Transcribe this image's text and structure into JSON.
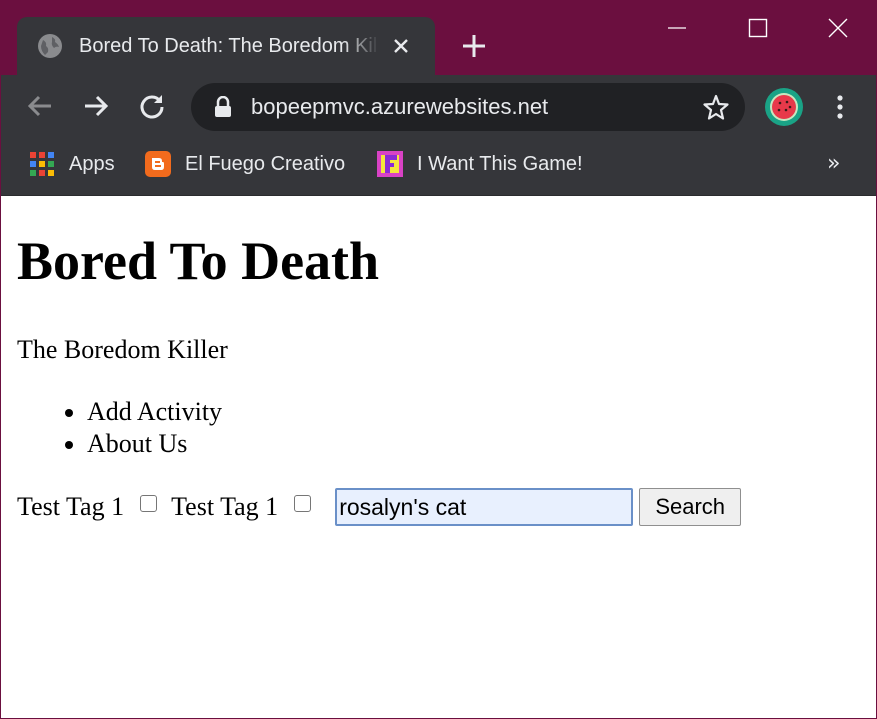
{
  "browser": {
    "tab_title": "Bored To Death: The Boredom Killer",
    "url": "bopeepmvc.azurewebsites.net",
    "bookmarks": [
      {
        "label": "Apps",
        "icon": "apps-grid-icon"
      },
      {
        "label": "El Fuego Creativo",
        "icon": "blogger-icon"
      },
      {
        "label": "I Want This Game!",
        "icon": "game-icon"
      }
    ],
    "bookmarks_more": "»",
    "colors": {
      "frame": "#6b0f3f",
      "toolbar": "#35363a",
      "omnibox": "#202124"
    }
  },
  "page": {
    "title": "Bored To Death",
    "subtitle": "The Boredom Killer",
    "nav": [
      "Add Activity",
      "About Us"
    ],
    "tags": [
      {
        "label": "Test Tag 1",
        "checked": false
      },
      {
        "label": "Test Tag 1",
        "checked": false
      }
    ],
    "search": {
      "value": "rosalyn's cat",
      "button_label": "Search"
    }
  }
}
